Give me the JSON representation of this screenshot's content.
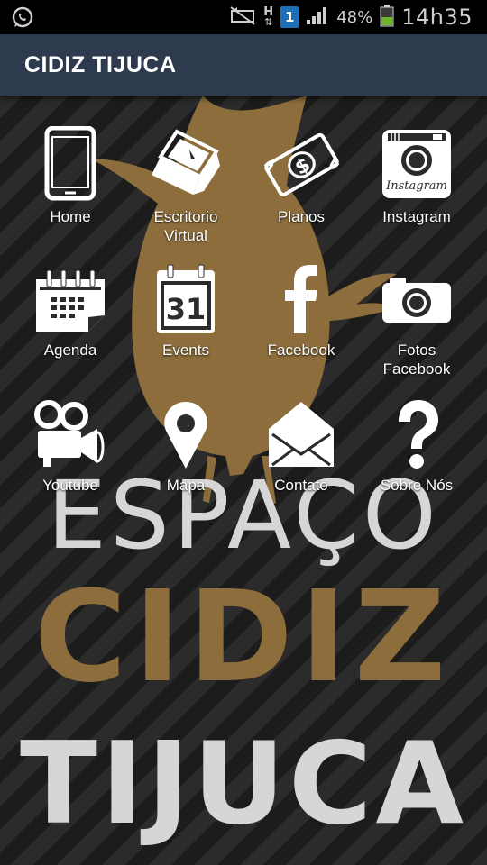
{
  "statusbar": {
    "network_h": "H",
    "sim_number": "1",
    "battery_percent": "48%",
    "time": "14h35",
    "icons": [
      "whatsapp-icon",
      "mute-icon",
      "data-arrows-icon",
      "sim-icon",
      "signal-icon",
      "battery-icon"
    ]
  },
  "appbar": {
    "title": "CIDIZ TIJUCA"
  },
  "menu": [
    {
      "label": "Home",
      "icon": "tablet-icon"
    },
    {
      "label": "Escritorio\nVirtual",
      "icon": "laptop-icon"
    },
    {
      "label": "Planos",
      "icon": "money-icon"
    },
    {
      "label": "Instagram",
      "icon": "instagram-icon"
    },
    {
      "label": "Agenda",
      "icon": "calendar-icon"
    },
    {
      "label": "Events",
      "icon": "calendar-31-icon"
    },
    {
      "label": "Facebook",
      "icon": "facebook-icon"
    },
    {
      "label": "Fotos\nFacebook",
      "icon": "camera-icon"
    },
    {
      "label": "Youtube",
      "icon": "video-camera-icon"
    },
    {
      "label": "Mapa",
      "icon": "map-pin-icon"
    },
    {
      "label": "Contato",
      "icon": "envelope-icon"
    },
    {
      "label": "Sobre Nós",
      "icon": "question-icon"
    }
  ],
  "background": {
    "line1": "ESPAÇO",
    "line2": "CIDIZ",
    "line3": "TIJUCA",
    "colors": {
      "gold": "#8c6d3b",
      "grey": "#d6d6d6",
      "appbar": "#2e3a4d"
    }
  },
  "icon_glyphs": {
    "calendar_day": "31",
    "instagram_word": "Instagram"
  }
}
